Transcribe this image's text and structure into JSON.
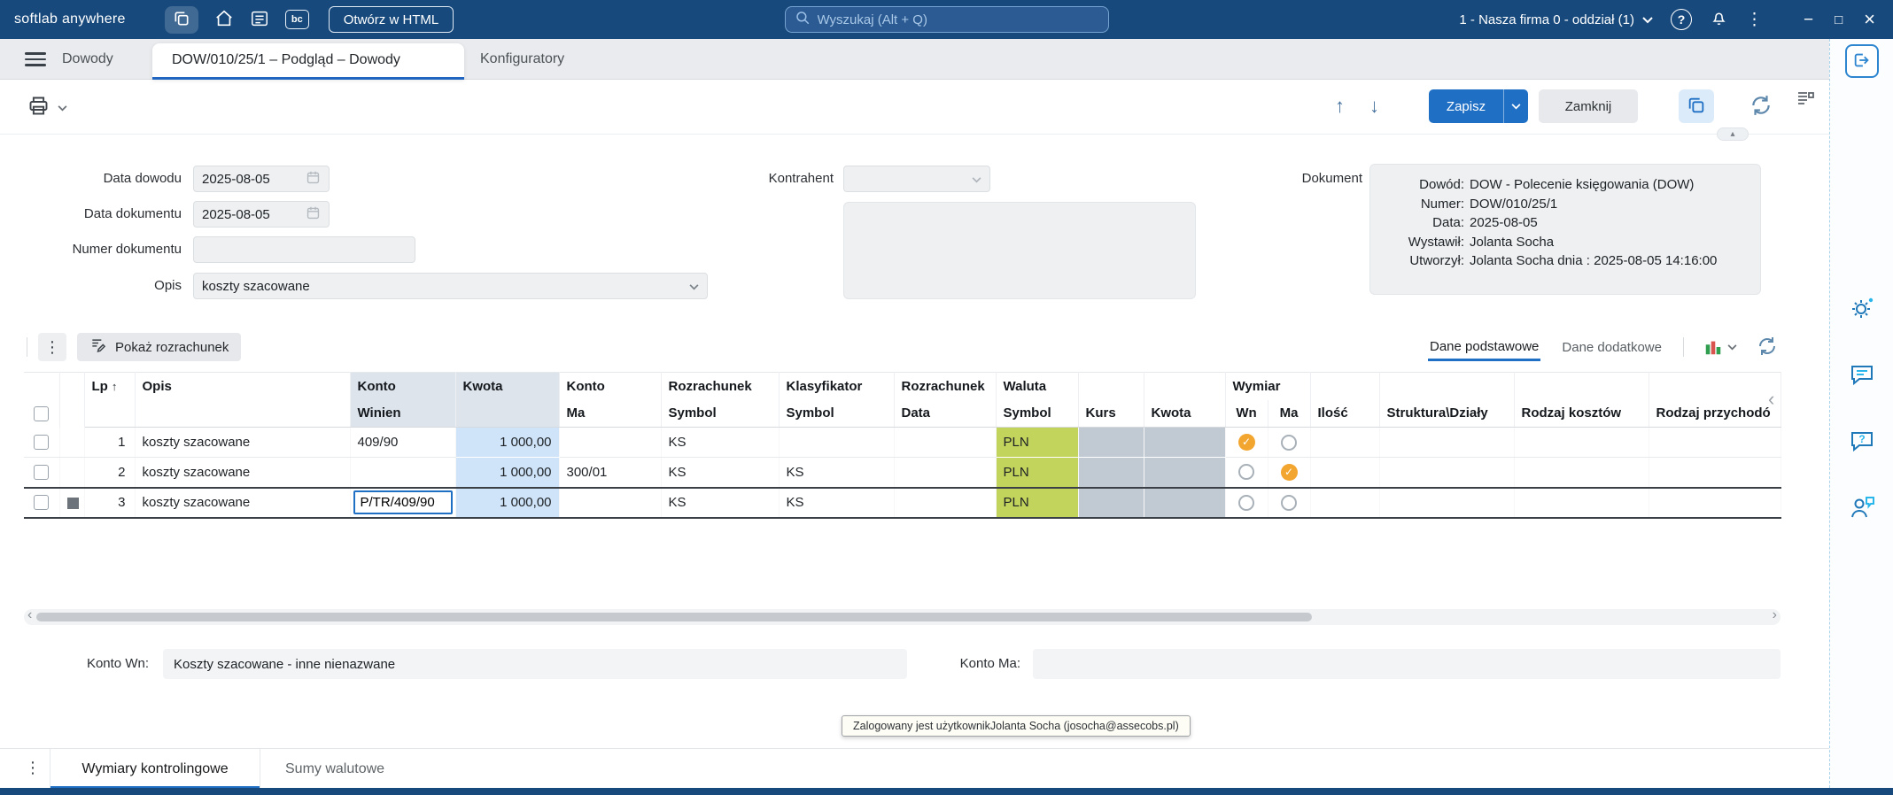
{
  "topbar": {
    "brand": "softlab anywhere",
    "bc_badge": "bc",
    "open_html_button": "Otwórz w HTML",
    "search_placeholder": "Wyszukaj (Alt + Q)",
    "company_selector": "1 - Nasza firma 0 - oddział (1)"
  },
  "tabbar": {
    "tab_dowody": "Dowody",
    "tab_active": "DOW/010/25/1 – Podgląd – Dowody",
    "tab_konfiguratory": "Konfiguratory"
  },
  "toolbar": {
    "save_button": "Zapisz",
    "close_button": "Zamknij"
  },
  "form": {
    "data_dowodu_label": "Data dowodu",
    "data_dowodu_value": "2025-08-05",
    "data_dokumentu_label": "Data dokumentu",
    "data_dokumentu_value": "2025-08-05",
    "numer_dokumentu_label": "Numer dokumentu",
    "numer_dokumentu_value": "",
    "opis_label": "Opis",
    "opis_value": "koszty szacowane",
    "kontrahent_label": "Kontrahent",
    "kontrahent_value": "",
    "dokument_label": "Dokument",
    "dokument_info": [
      {
        "label": "Dowód:",
        "value": "DOW - Polecenie księgowania (DOW)"
      },
      {
        "label": "Numer:",
        "value": "DOW/010/25/1"
      },
      {
        "label": "Data:",
        "value": "2025-08-05"
      },
      {
        "label": "Wystawił:",
        "value": "Jolanta Socha"
      },
      {
        "label": "Utworzył:",
        "value": "Jolanta Socha dnia : 2025-08-05 14:16:00"
      }
    ]
  },
  "grid": {
    "show_settlement_button": "Pokaż rozrachunek",
    "tab_primary": "Dane podstawowe",
    "tab_secondary": "Dane dodatkowe",
    "columns": [
      {
        "l1": "Lp",
        "l2": "",
        "sorted": "asc"
      },
      {
        "l1": "Opis",
        "l2": ""
      },
      {
        "l1": "Konto",
        "l2": "Winien"
      },
      {
        "l1": "Kwota",
        "l2": ""
      },
      {
        "l1": "Konto",
        "l2": "Ma"
      },
      {
        "l1": "Rozrachunek",
        "l2": "Symbol"
      },
      {
        "l1": "Klasyfikator",
        "l2": "Symbol"
      },
      {
        "l1": "Rozrachunek",
        "l2": "Data"
      },
      {
        "l1": "Waluta",
        "l2": "Symbol"
      },
      {
        "l1": "",
        "l2": "Kurs"
      },
      {
        "l1": "",
        "l2": "Kwota"
      },
      {
        "l1": "Wymiar",
        "l2": "Wn"
      },
      {
        "l1": "",
        "l2": "Ma"
      },
      {
        "l1": "",
        "l2": "Ilość"
      },
      {
        "l1": "",
        "l2": "Struktura\\Działy"
      },
      {
        "l1": "",
        "l2": "Rodzaj kosztów"
      },
      {
        "l1": "",
        "l2": "Rodzaj przychodó"
      }
    ],
    "rows": [
      {
        "lp": "1",
        "opis": "koszty szacowane",
        "konto_winien": "409/90",
        "kwota": "1 000,00",
        "konto_ma": "",
        "rozrachunek_symbol": "KS",
        "klasyfikator_symbol": "",
        "rozrachunek_data": "",
        "waluta_symbol": "PLN",
        "kurs": "",
        "kwota_waluta": "",
        "wymiar_wn": true,
        "wymiar_ma": false,
        "ilosc": "",
        "struktura_dzialy": "",
        "rodzaj_kosztow": "",
        "rodzaj_przychodow": "",
        "selected": false
      },
      {
        "lp": "2",
        "opis": "koszty szacowane",
        "konto_winien": "",
        "kwota": "1 000,00",
        "konto_ma": "300/01",
        "rozrachunek_symbol": "KS",
        "klasyfikator_symbol": "KS",
        "rozrachunek_data": "",
        "waluta_symbol": "PLN",
        "kurs": "",
        "kwota_waluta": "",
        "wymiar_wn": false,
        "wymiar_ma": true,
        "ilosc": "",
        "struktura_dzialy": "",
        "rodzaj_kosztow": "",
        "rodzaj_przychodow": "",
        "selected": false
      },
      {
        "lp": "3",
        "opis": "koszty szacowane",
        "konto_winien": "P/TR/409/90",
        "kwota": "1 000,00",
        "konto_ma": "",
        "rozrachunek_symbol": "KS",
        "klasyfikator_symbol": "KS",
        "rozrachunek_data": "",
        "waluta_symbol": "PLN",
        "kurs": "",
        "kwota_waluta": "",
        "wymiar_wn": false,
        "wymiar_ma": false,
        "ilosc": "",
        "struktura_dzialy": "",
        "rodzaj_kosztow": "",
        "rodzaj_przychodow": "",
        "selected": true,
        "editing_cell": "konto_winien"
      }
    ]
  },
  "footer": {
    "konto_wn_label": "Konto Wn:",
    "konto_wn_value": "Koszty szacowane - inne nienazwane",
    "konto_ma_label": "Konto Ma:",
    "konto_ma_value": ""
  },
  "tooltip": "Zalogowany jest użytkownikJolanta Socha (josocha@assecobs.pl)",
  "bottom_tabs": {
    "tab_wymiary": "Wymiary kontrolingowe",
    "tab_sumy": "Sumy walutowe"
  },
  "icons": {
    "sort_ascending": "↑",
    "nav_up": "↑",
    "nav_down": "↓",
    "kebab": "⋮",
    "scroll_left": "‹",
    "scroll_right": "›",
    "help": "?",
    "chevron_up": "▴",
    "minimize": "−",
    "maximize": "□",
    "close": "×"
  },
  "colors": {
    "topbar_bg": "#17497C",
    "accent_blue": "#1F6FC5",
    "amount_cell_bg": "#CFE4F8",
    "currency_cell_bg": "#C3D45C",
    "readonly_cell_bg": "#C1CAD2",
    "checked_radio_bg": "#F2A52F"
  }
}
